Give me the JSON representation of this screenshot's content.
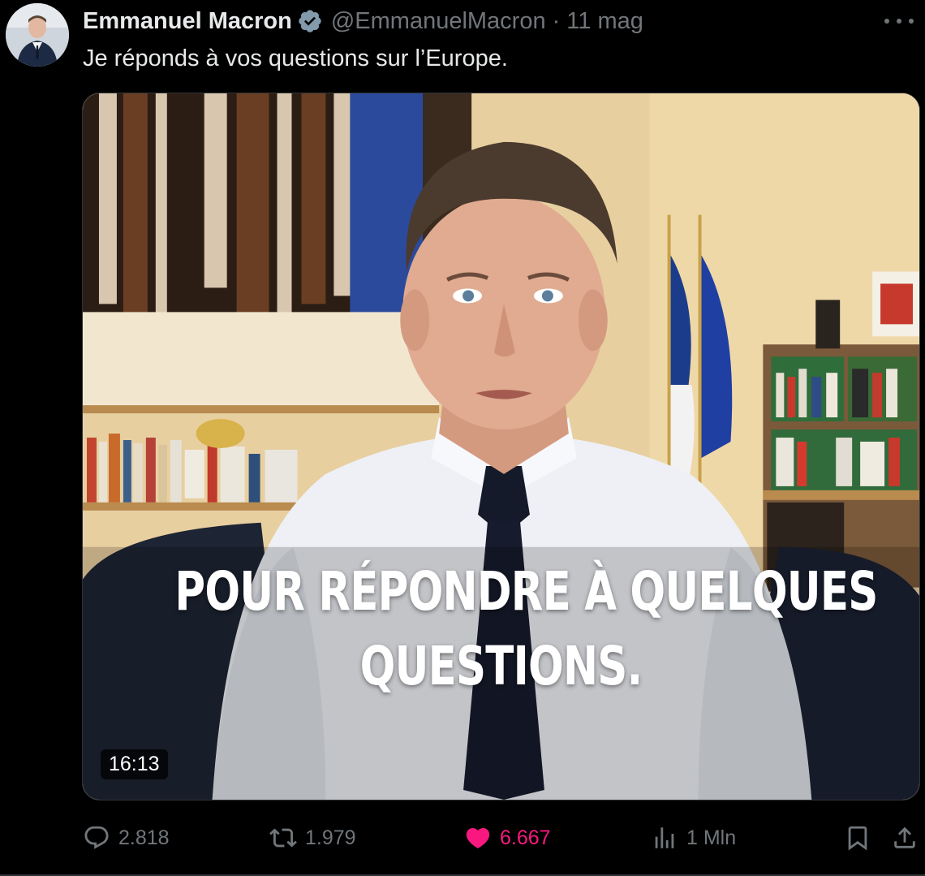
{
  "author": {
    "display_name": "Emmanuel Macron",
    "handle": "@EmmanuelMacron",
    "separator": "·",
    "time": "11 mag",
    "verified_icon": "verified-badge-icon",
    "avatar_icon": "avatar"
  },
  "tweet": {
    "text": "Je réponds à vos questions sur l’Europe."
  },
  "media": {
    "caption_line1": "POUR RÉPONDRE À QUELQUES",
    "caption_line2": "QUESTIONS.",
    "duration": "16:13"
  },
  "actions": {
    "reply_count": "2.818",
    "retweet_count": "1.979",
    "like_count": "6.667",
    "views_count": "1 Mln"
  },
  "colors": {
    "background": "#000000",
    "text": "#e7e9ea",
    "muted": "#71767b",
    "like": "#f91880",
    "verified": "#829aab"
  }
}
